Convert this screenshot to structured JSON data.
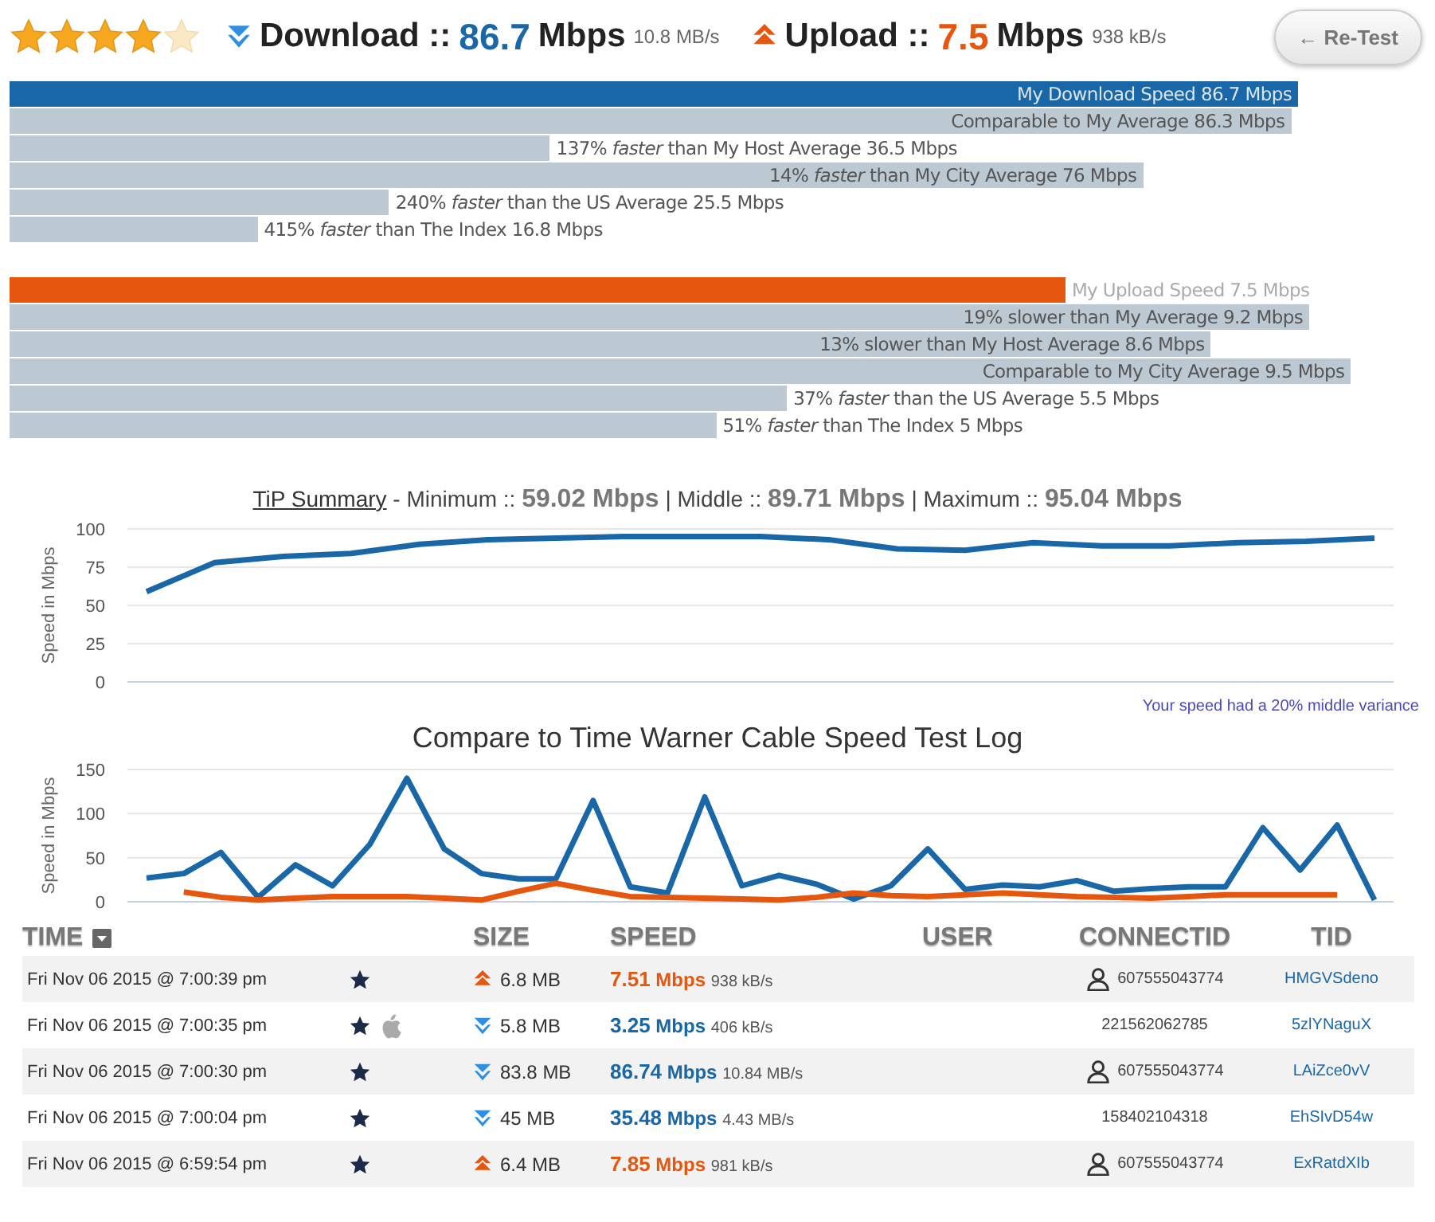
{
  "rating": {
    "stars": 4
  },
  "summary": {
    "download_label": "Download ::",
    "download_value": "86.7",
    "download_unit": "Mbps",
    "download_rate": "10.8 MB/s",
    "upload_label": "Upload ::",
    "upload_value": "7.5",
    "upload_unit": "Mbps",
    "upload_rate": "938 kB/s"
  },
  "retest_button": "← Re-Test",
  "download_bars": [
    {
      "kind": "inside",
      "label": "My Download Speed 86.7 Mbps",
      "level": 0.93,
      "color": "#1a67a8"
    },
    {
      "kind": "inside",
      "label": "Comparable to My Average 86.3 Mbps",
      "level": 0.925,
      "color": "#bcc8d2"
    },
    {
      "kind": "outside",
      "label": "137% *faster* than My Host Average 36.5 Mbps",
      "level": 0.39,
      "color": "#bcc8d2"
    },
    {
      "kind": "inside",
      "label": "14% *faster* than My City Average 76 Mbps",
      "level": 0.818,
      "color": "#bcc8d2"
    },
    {
      "kind": "outside",
      "label": "240% *faster* than the US Average 25.5 Mbps",
      "level": 0.274,
      "color": "#bcc8d2"
    },
    {
      "kind": "outside",
      "label": "415% *faster* than The Index 16.8 Mbps",
      "level": 0.179,
      "color": "#bcc8d2"
    }
  ],
  "upload_bars": [
    {
      "kind": "outside",
      "label": "My Upload Speed 7.5 Mbps",
      "level": 0.762,
      "color": "#e5570f"
    },
    {
      "kind": "inside",
      "label": "19% slower than My Average 9.2 Mbps",
      "level": 0.938,
      "color": "#bcc8d2"
    },
    {
      "kind": "inside",
      "label": "13% slower than My Host Average 8.6 Mbps",
      "level": 0.867,
      "color": "#bcc8d2"
    },
    {
      "kind": "inside",
      "label": "Comparable to My City Average 9.5 Mbps",
      "level": 0.968,
      "color": "#bcc8d2"
    },
    {
      "kind": "outside",
      "label": "37% *faster* than the US Average 5.5 Mbps",
      "level": 0.561,
      "color": "#bcc8d2"
    },
    {
      "kind": "outside",
      "label": "51% *faster* than The Index 5 Mbps",
      "level": 0.51,
      "color": "#bcc8d2"
    }
  ],
  "tip_summary": {
    "link": "TiP Summary",
    "text": "- Minimum :: **59.02 Mbps** | Middle :: **89.71 Mbps** | Maximum :: **95.04 Mbps**",
    "chart_data": {
      "type": "line",
      "grid": true,
      "ylabel": "Speed in Mbps",
      "ylim": [
        0,
        100
      ],
      "yticks": [
        0,
        25,
        50,
        75,
        100
      ],
      "series": [
        {
          "color": "#1a67a8",
          "values": [
            59,
            78,
            82,
            84,
            90,
            93,
            94,
            95,
            95,
            95,
            93,
            87,
            86,
            91,
            89,
            89,
            91,
            92,
            94
          ]
        }
      ]
    },
    "note": "Your speed had a 20% middle variance"
  },
  "compare_chart": {
    "chart_data": {
      "type": "line",
      "title": "Compare to Time Warner Cable Speed Test Log",
      "grid": true,
      "ylabel": "Speed in Mbps",
      "ylim": [
        0,
        150
      ],
      "yticks": [
        0,
        50,
        100,
        150
      ],
      "series": [
        {
          "color": "#1a67a8",
          "values": [
            27,
            32,
            56,
            5,
            42,
            18,
            65,
            140,
            60,
            32,
            26,
            26,
            115,
            17,
            10,
            119,
            18,
            30,
            20,
            3,
            18,
            60,
            14,
            19,
            17,
            24,
            12,
            15,
            17,
            17,
            84,
            36,
            87,
            2
          ]
        },
        {
          "color": "#e5570f",
          "values": [
            null,
            11,
            5,
            2,
            4,
            6,
            6,
            6,
            4,
            2,
            12,
            21,
            13,
            6,
            5,
            4,
            3,
            2,
            5,
            10,
            7,
            6,
            8,
            10,
            8,
            6,
            5,
            4,
            6,
            8,
            8,
            8,
            8,
            null
          ]
        }
      ]
    }
  },
  "table": {
    "columns": [
      "TIME",
      "SIZE",
      "SPEED",
      "USER",
      "CONNECTID",
      "TID"
    ],
    "rows": [
      {
        "time": "Fri Nov 06 2015 @ 7:00:39 pm",
        "apple": false,
        "kind": "up",
        "size": "6.8 MB",
        "speed": "7.51",
        "unit": "Mbps",
        "rate": "938 kB/s",
        "user_icon": true,
        "connectid": "607555043774",
        "tid": "HMGVSdeno"
      },
      {
        "time": "Fri Nov 06 2015 @ 7:00:35 pm",
        "apple": true,
        "kind": "down",
        "size": "5.8 MB",
        "speed": "3.25",
        "unit": "Mbps",
        "rate": "406 kB/s",
        "user_icon": false,
        "connectid": "221562062785",
        "tid": "5zlYNaguX"
      },
      {
        "time": "Fri Nov 06 2015 @ 7:00:30 pm",
        "apple": false,
        "kind": "down",
        "size": "83.8 MB",
        "speed": "86.74",
        "unit": "Mbps",
        "rate": "10.84 MB/s",
        "user_icon": true,
        "connectid": "607555043774",
        "tid": "LAiZce0vV"
      },
      {
        "time": "Fri Nov 06 2015 @ 7:00:04 pm",
        "apple": false,
        "kind": "down",
        "size": "45 MB",
        "speed": "35.48",
        "unit": "Mbps",
        "rate": "4.43 MB/s",
        "user_icon": false,
        "connectid": "158402104318",
        "tid": "EhSIvD54w"
      },
      {
        "time": "Fri Nov 06 2015 @ 6:59:54 pm",
        "apple": false,
        "kind": "up",
        "size": "6.4 MB",
        "speed": "7.85",
        "unit": "Mbps",
        "rate": "981 kB/s",
        "user_icon": true,
        "connectid": "607555043774",
        "tid": "ExRatdXIb"
      }
    ]
  }
}
